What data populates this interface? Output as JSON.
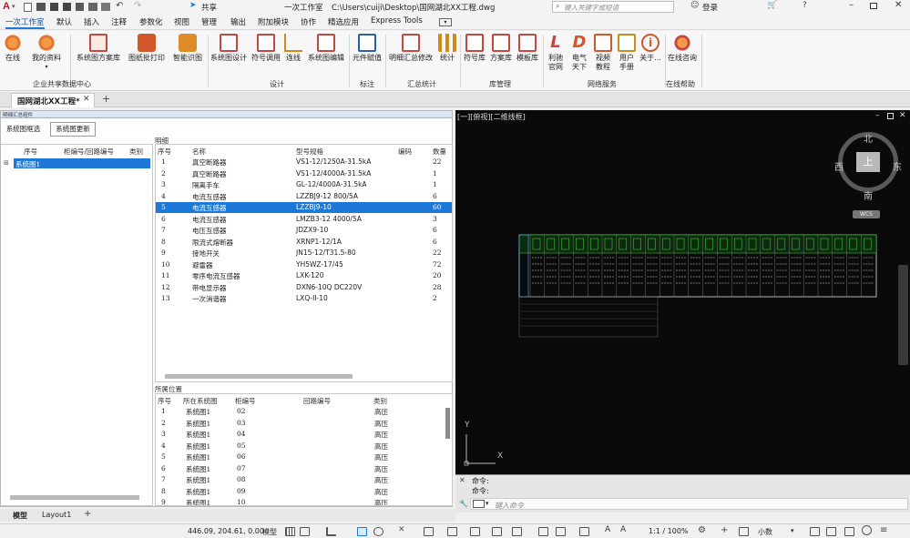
{
  "titlebar": {
    "workspace": "一次工作室",
    "share_label": "共享",
    "path": "C:\\Users\\cuiji\\Desktop\\国网湖北XX工程.dwg",
    "search_placeholder": "键入关键字或短语",
    "login_label": "登录"
  },
  "menu": [
    "一次工作室",
    "默认",
    "插入",
    "注释",
    "参数化",
    "视图",
    "管理",
    "输出",
    "附加模块",
    "协作",
    "精选应用",
    "Express Tools"
  ],
  "ribbon": {
    "buttons": [
      {
        "label": "在线",
        "color": "#e8732a"
      },
      {
        "label": "我的资料",
        "color": "#e8732a"
      },
      {
        "label": "系统图方案库",
        "color": "#c9463d"
      },
      {
        "label": "图纸批打印",
        "color": "#d2572a"
      },
      {
        "label": "智能识图",
        "color": "#e08a2a"
      },
      {
        "label": "系统图设计",
        "color": "#c9463d"
      },
      {
        "label": "符号调用",
        "color": "#c9463d"
      },
      {
        "label": "连线",
        "color": "#d08a1a"
      },
      {
        "label": "系统图编辑",
        "color": "#c9463d"
      },
      {
        "label": "元件赋值",
        "color": "#2a5fb0"
      },
      {
        "label": "明细汇总修改",
        "color": "#c9463d"
      },
      {
        "label": "统计",
        "color": "#d08a1a"
      },
      {
        "label": "符号库",
        "color": "#c9463d"
      },
      {
        "label": "方案库",
        "color": "#c9463d"
      },
      {
        "label": "模板库",
        "color": "#c9463d"
      },
      {
        "label": "利驰\n官网",
        "color": "#c9463d"
      },
      {
        "label": "电气\n天下",
        "color": "#d2572a"
      },
      {
        "label": "视频\n教程",
        "color": "#d2572a"
      },
      {
        "label": "用户\n手册",
        "color": "#d08a1a"
      },
      {
        "label": "关于...",
        "color": "#d2572a"
      },
      {
        "label": "在线咨询",
        "color": "#c9463d"
      }
    ],
    "groups": [
      "企业共享数据中心",
      "设计",
      "标注",
      "汇总统计",
      "库管理",
      "网络服务",
      "在线帮助"
    ]
  },
  "doc_tab": "国网湖北XX工程*",
  "panel": {
    "title": "明细汇总组件",
    "btn_filter": "系统图框选",
    "btn_update": "系统图更新",
    "tree_headers": [
      "序号",
      "柜编号/回路编号",
      "类别"
    ],
    "tree_item": "系统图1",
    "detail_title": "明细",
    "detail_headers": [
      "序号",
      "名称",
      "型号规格",
      "编码",
      "数量"
    ],
    "detail_rows": [
      [
        "1",
        "真空断路器",
        "VS1-12/1250A-31.5kA",
        "",
        "22"
      ],
      [
        "2",
        "真空断路器",
        "VS1-12/4000A-31.5kA",
        "",
        "1"
      ],
      [
        "3",
        "隔离手车",
        "GL-12/4000A-31.5kA",
        "",
        "1"
      ],
      [
        "4",
        "电流互感器",
        "LZZBJ9-12 800/5A",
        "",
        "6"
      ],
      [
        "5",
        "电流互感器",
        "LZZBJ9-10",
        "",
        "60"
      ],
      [
        "6",
        "电流互感器",
        "LMZB3-12 4000/5A",
        "",
        "3"
      ],
      [
        "7",
        "电压互感器",
        "JDZX9-10",
        "",
        "6"
      ],
      [
        "8",
        "限流式熔断器",
        "XRNP1-12/1A",
        "",
        "6"
      ],
      [
        "9",
        "接地开关",
        "JN15-12/T31.5-80",
        "",
        "22"
      ],
      [
        "10",
        "避雷器",
        "YH5WZ-17/45",
        "",
        "72"
      ],
      [
        "11",
        "零序电流互感器",
        "LXK-120",
        "",
        "20"
      ],
      [
        "12",
        "带电显示器",
        "DXN6-10Q DC220V",
        "",
        "28"
      ],
      [
        "13",
        "一次消谐器",
        "LXQ-II-10",
        "",
        "2"
      ]
    ],
    "location_title": "所属位置",
    "location_headers": [
      "序号",
      "所在系统图",
      "柜编号",
      "回路编号",
      "类别"
    ],
    "location_rows": [
      [
        "1",
        "系统图1",
        "02",
        "",
        "高压"
      ],
      [
        "2",
        "系统图1",
        "03",
        "",
        "高压"
      ],
      [
        "3",
        "系统图1",
        "04",
        "",
        "高压"
      ],
      [
        "4",
        "系统图1",
        "05",
        "",
        "高压"
      ],
      [
        "5",
        "系统图1",
        "06",
        "",
        "高压"
      ],
      [
        "6",
        "系统图1",
        "07",
        "",
        "高压"
      ],
      [
        "7",
        "系统图1",
        "08",
        "",
        "高压"
      ],
      [
        "8",
        "系统图1",
        "09",
        "",
        "高压"
      ],
      [
        "9",
        "系统图1",
        "10",
        "",
        "高压"
      ]
    ]
  },
  "viewport": {
    "label": "[一][俯视][二维线框]",
    "compass": {
      "north": "北",
      "south": "南",
      "east": "东",
      "west": "西",
      "center": "上",
      "wcs": "WCS"
    },
    "axis_x": "X",
    "axis_y": "Y"
  },
  "command": {
    "line1": "命令:",
    "line2": "命令:",
    "placeholder": "键入命令"
  },
  "layout_tabs": [
    "模型",
    "Layout1"
  ],
  "status": {
    "coords": "446.09, 204.61, 0.00",
    "model": "模型",
    "scale": "1:1 / 100%",
    "units": "小数"
  },
  "colors": {
    "accent": "#1e78d7",
    "viewport_bg": "#0a0a0a"
  }
}
